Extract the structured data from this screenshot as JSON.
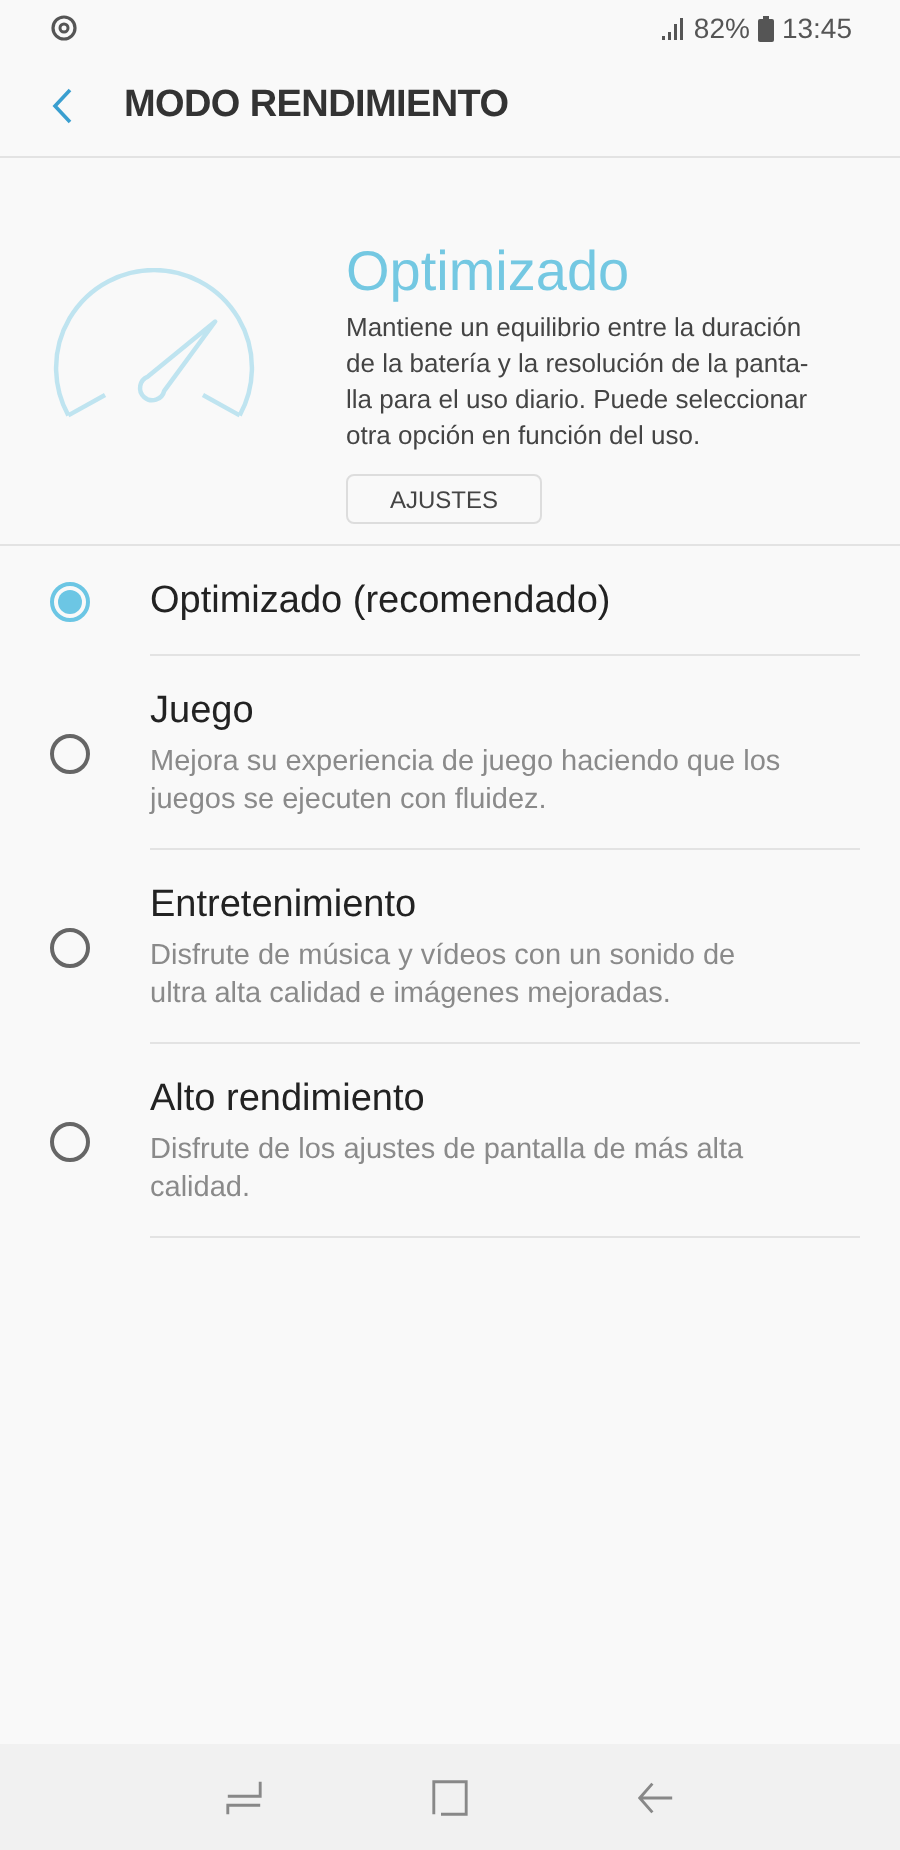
{
  "status_bar": {
    "battery": "82%",
    "time": "13:45"
  },
  "header": {
    "title": "MODO RENDIMIENTO"
  },
  "hero": {
    "title": "Optimizado",
    "description_lines": [
      "Mantiene un equilibrio entre la duración",
      "de la batería y la resolución de la panta-",
      "lla para el uso diario. Puede seleccionar",
      "otra opción en función del uso."
    ],
    "button": "AJUSTES"
  },
  "options": [
    {
      "label": "Optimizado (recomendado)",
      "selected": true
    },
    {
      "label": "Juego",
      "description_lines": [
        "Mejora su experiencia de juego haciendo que los",
        "juegos se ejecuten con fluidez."
      ],
      "selected": false
    },
    {
      "label": "Entretenimiento",
      "description_lines": [
        "Disfrute de música y vídeos con un sonido de",
        "ultra alta calidad e imágenes mejoradas."
      ],
      "selected": false
    },
    {
      "label": "Alto rendimiento",
      "description_lines": [
        "Disfrute de los ajustes de pantalla de más alta",
        "calidad."
      ],
      "selected": false
    }
  ]
}
